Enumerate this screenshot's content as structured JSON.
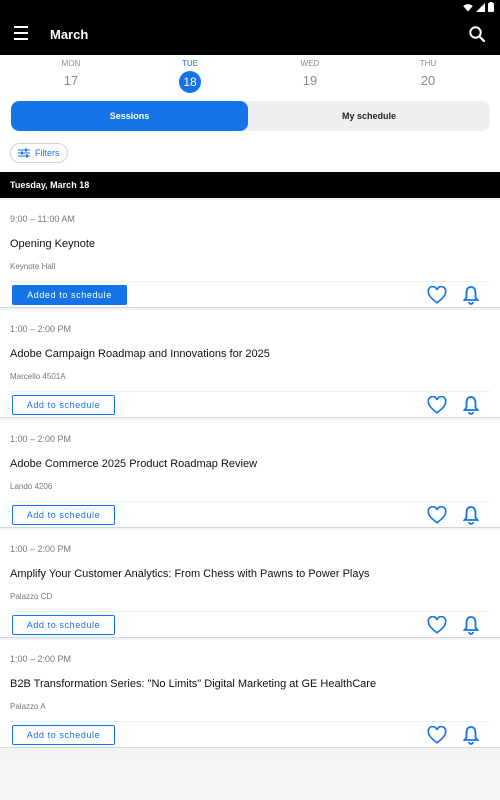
{
  "appbar": {
    "title": "March"
  },
  "days": [
    {
      "dow": "MON",
      "num": "17"
    },
    {
      "dow": "TUE",
      "num": "18"
    },
    {
      "dow": "WED",
      "num": "19"
    },
    {
      "dow": "THU",
      "num": "20"
    }
  ],
  "tabs": {
    "sessions": "Sessions",
    "my_schedule": "My schedule"
  },
  "filters": {
    "label": "Filters"
  },
  "date_header": "Tuesday, March 18",
  "sessions": [
    {
      "time": "9:00 – 11:00 AM",
      "title": "Opening Keynote",
      "location": "Keynote Hall",
      "button": "Added to schedule"
    },
    {
      "time": "1:00 – 2:00 PM",
      "title": "Adobe Campaign Roadmap and Innovations for 2025",
      "location": "Marcello 4501A",
      "button": "Add to schedule"
    },
    {
      "time": "1:00 – 2:00 PM",
      "title": "Adobe Commerce 2025 Product Roadmap Review",
      "location": "Lando 4206",
      "button": "Add to schedule"
    },
    {
      "time": "1:00 – 2:00 PM",
      "title": "Amplify Your Customer Analytics: From Chess with Pawns to Power Plays",
      "location": "Palazzo CD",
      "button": "Add to schedule"
    },
    {
      "time": "1:00 – 2:00 PM",
      "title": "B2B Transformation Series: \"No Limits\" Digital Marketing at GE HealthCare",
      "location": "Palazzo A",
      "button": "Add to schedule"
    }
  ],
  "colors": {
    "accent": "#1473e6",
    "appbar": "#000000"
  },
  "icons": {
    "menu": "hamburger-menu-icon",
    "search": "search-icon",
    "filter": "sliders-icon",
    "favorite": "heart-icon",
    "notify": "bell-icon",
    "wifi": "wifi-icon",
    "battery": "battery-icon"
  }
}
